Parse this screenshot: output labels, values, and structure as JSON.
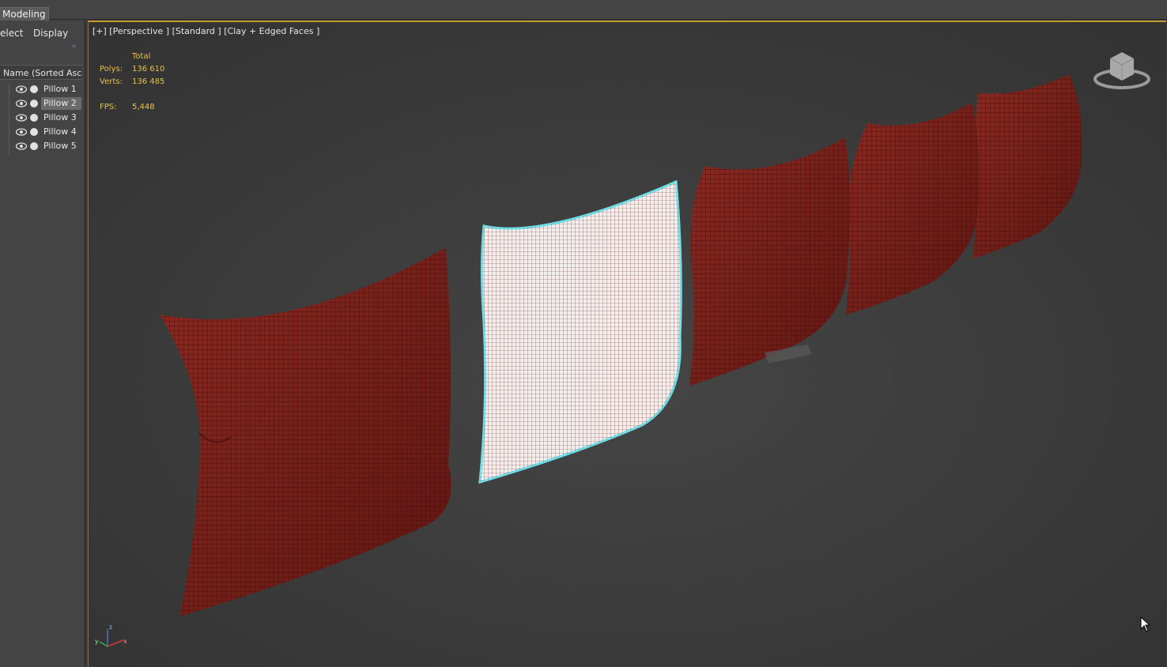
{
  "ribbon": {
    "active_tab": "Modeling"
  },
  "scene_explorer": {
    "tabs": [
      "elect",
      "Display"
    ],
    "column_header": "Name (Sorted Ascending)",
    "items": [
      {
        "label": "Pillow 1",
        "selected": false
      },
      {
        "label": "Pillow 2",
        "selected": true
      },
      {
        "label": "Pillow 3",
        "selected": false
      },
      {
        "label": "Pillow 4",
        "selected": false
      },
      {
        "label": "Pillow 5",
        "selected": false
      }
    ]
  },
  "viewport": {
    "label": "[+] [Perspective ] [Standard ] [Clay + Edged Faces ]",
    "stats": {
      "total_label": "Total",
      "polys_label": "Polys:",
      "polys_value": "136 610",
      "verts_label": "Verts:",
      "verts_value": "136 485",
      "fps_label": "FPS:",
      "fps_value": "5,448"
    },
    "axis_labels": {
      "x": "x",
      "y": "y",
      "z": "z"
    }
  },
  "colors": {
    "pillow_fill": "#7a1f1a",
    "selected_outline": "#6fe3ee",
    "stats_text": "#e8c24a",
    "viewport_border": "#c49a2c"
  },
  "icons": {
    "visibility": "eye-icon",
    "freeze": "dot-icon",
    "viewcube": "viewcube-icon",
    "axis": "axis-tripod-icon",
    "cursor": "mouse-cursor-icon"
  }
}
